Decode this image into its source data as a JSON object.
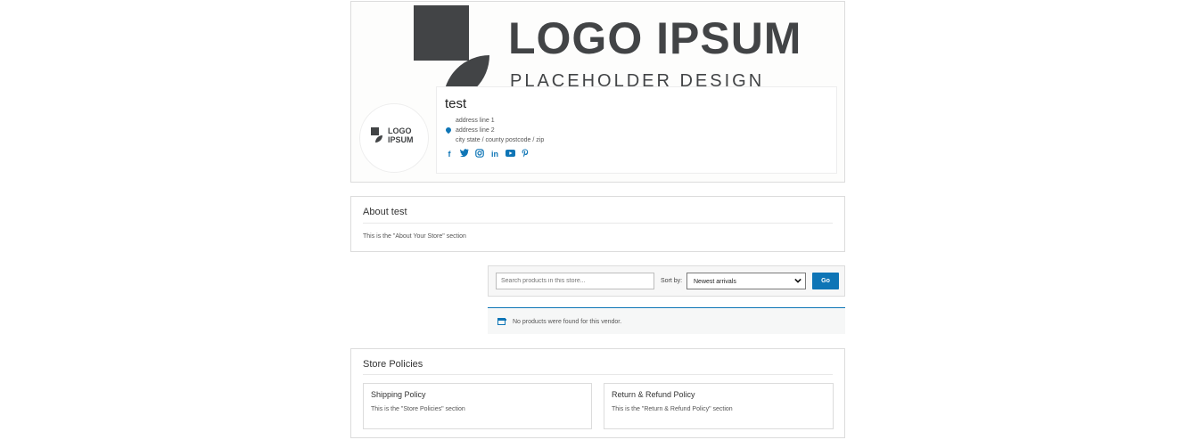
{
  "header": {
    "banner_logo_text": "LOGO IPSUM",
    "banner_sub_text": "PLACEHOLDER DESIGN",
    "store_name": "test",
    "address_line_1": "address line 1",
    "address_line_2": "address line 2",
    "address_line_3": "city state / county postcode / zip",
    "avatar_logo_text_1": "LOGO",
    "avatar_logo_text_2": "IPSUM",
    "social_icons": [
      "facebook-icon",
      "twitter-icon",
      "instagram-icon",
      "linkedin-icon",
      "youtube-icon",
      "pinterest-icon"
    ]
  },
  "about": {
    "title": "About test",
    "body": "This is the \"About Your Store\" section"
  },
  "search": {
    "placeholder": "Search products in this store...",
    "sort_label": "Sort by:",
    "sort_selected": "Newest arrivals",
    "go_label": "Go"
  },
  "notice": {
    "text": "No products were found for this vendor."
  },
  "policies": {
    "title": "Store Policies",
    "items": [
      {
        "title": "Shipping Policy",
        "body": "This is the \"Store Policies\" section"
      },
      {
        "title": "Return & Refund Policy",
        "body": "This is the \"Return & Refund Policy\" section"
      }
    ]
  },
  "colors": {
    "accent": "#0e75b6",
    "logo_gray": "#424446",
    "border": "#dcdcdc"
  }
}
